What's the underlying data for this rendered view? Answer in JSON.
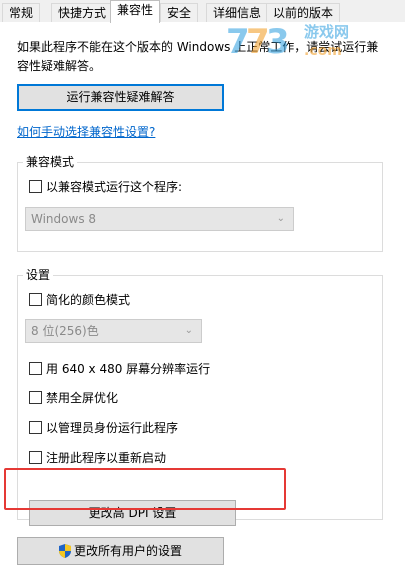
{
  "tabs": [
    "常规",
    "快捷方式",
    "兼容性",
    "安全",
    "详细信息",
    "以前的版本"
  ],
  "intro": "如果此程序不能在这个版本的 Windows 上正常工作，请尝试运行兼容性疑难解答。",
  "troubleshoot_button": "运行兼容性疑难解答",
  "manual_link": "如何手动选择兼容性设置?",
  "compat_mode": {
    "title": "兼容模式",
    "checkbox": "以兼容模式运行这个程序:",
    "combo_value": "Windows 8"
  },
  "settings": {
    "title": "设置",
    "reduced_color": "简化的颜色模式",
    "color_combo": "8 位(256)色",
    "res640": "用 640 x 480 屏幕分辨率运行",
    "disable_fullscreen": "禁用全屏优化",
    "run_admin": "以管理员身份运行此程序",
    "register_restart": "注册此程序以重新启动",
    "dpi_button": "更改高 DPI 设置"
  },
  "all_users_button": "更改所有用户的设置",
  "watermark": "773 游戏网 .com",
  "colors": {
    "accent": "#0078d7",
    "highlight": "#e53935",
    "link": "#0066cc"
  }
}
